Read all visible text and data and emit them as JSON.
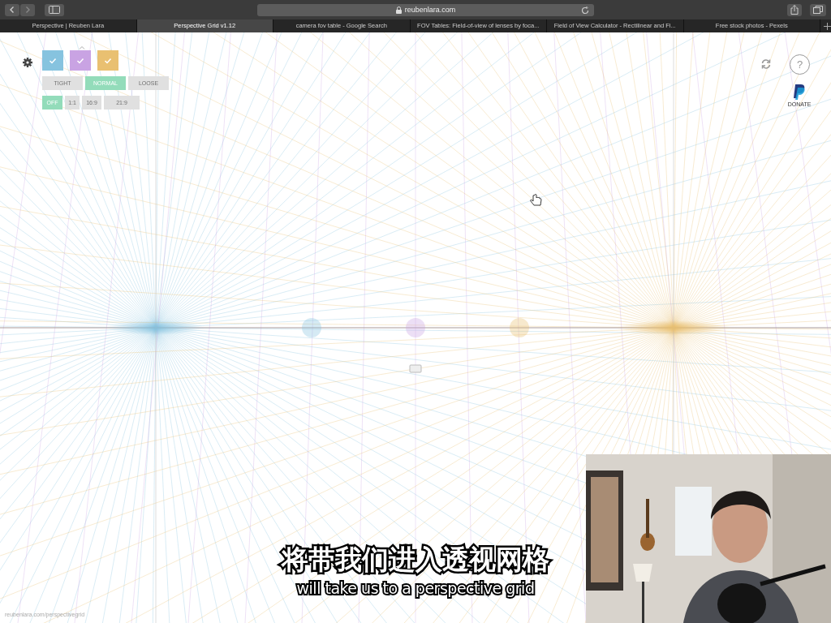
{
  "browser": {
    "url": "reubenlara.com",
    "tabs": [
      {
        "label": "Perspective | Reuben Lara",
        "selected": false
      },
      {
        "label": "Perspective Grid v1.12",
        "selected": true
      },
      {
        "label": "camera fov table - Google Search",
        "selected": false
      },
      {
        "label": "FOV Tables: Field-of-view of lenses by foca...",
        "selected": false
      },
      {
        "label": "Field of View Calculator - Rectilinear and Fi...",
        "selected": false
      },
      {
        "label": "Free stock photos - Pexels",
        "selected": false
      }
    ]
  },
  "swatches": [
    {
      "color": "#86c3df",
      "checked": true
    },
    {
      "color": "#c9a3e3",
      "checked": true
    },
    {
      "color": "#e9c071",
      "checked": true
    }
  ],
  "spacing": [
    {
      "label": "TIGHT",
      "selected": false
    },
    {
      "label": "NORMAL",
      "selected": true
    },
    {
      "label": "LOOSE",
      "selected": false
    }
  ],
  "aspect": [
    {
      "label": "OFF",
      "selected": true
    },
    {
      "label": "1:1",
      "selected": false
    },
    {
      "label": "16:9",
      "selected": false
    },
    {
      "label": "21:9",
      "selected": false
    }
  ],
  "help": {
    "label": "?"
  },
  "donate": {
    "label": "DONATE"
  },
  "footer_link": "reubenlara.com/perspectivegrid",
  "subtitles": {
    "chinese": "将带我们进入透视网格",
    "english": "will take us to a perspective grid"
  }
}
